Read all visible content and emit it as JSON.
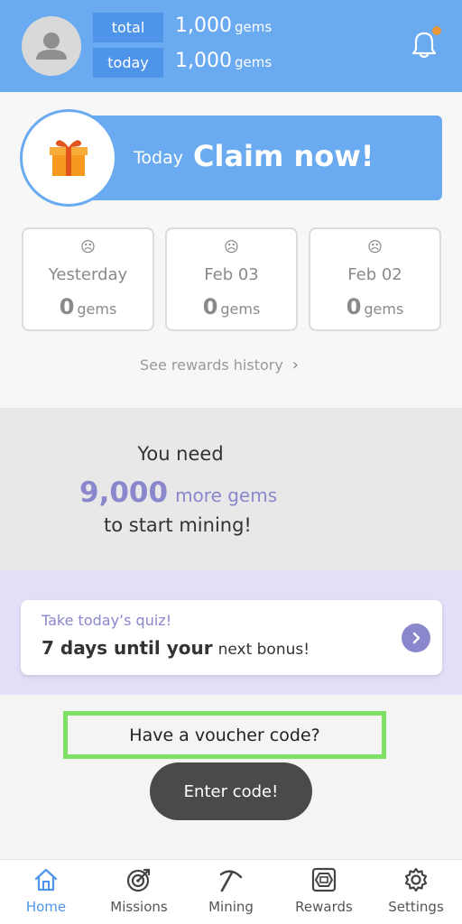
{
  "header": {
    "total_label": "total",
    "total_value": "1,000",
    "total_unit": "gems",
    "today_label": "today",
    "today_value": "1,000",
    "today_unit": "gems"
  },
  "claim": {
    "today_label": "Today",
    "cta": "Claim now!"
  },
  "history": {
    "days": [
      {
        "face": "☹",
        "name": "Yesterday",
        "gems": "0",
        "unit": "gems"
      },
      {
        "face": "☹",
        "name": "Feb 03",
        "gems": "0",
        "unit": "gems"
      },
      {
        "face": "☹",
        "name": "Feb 02",
        "gems": "0",
        "unit": "gems"
      }
    ],
    "link_label": "See rewards history",
    "link_chevron": "›"
  },
  "mining_need": {
    "line1": "You need",
    "amount": "9,000",
    "amount_suffix": "more gems",
    "line3": "to start mining!"
  },
  "quiz": {
    "title": "Take today’s quiz!",
    "subtitle_strong": "7 days until your",
    "subtitle_light": "next bonus!"
  },
  "voucher": {
    "question": "Have a voucher code?",
    "button_label": "Enter code!"
  },
  "nav": {
    "items": [
      {
        "label": "Home",
        "icon": "home-icon",
        "active": true
      },
      {
        "label": "Missions",
        "icon": "target-icon",
        "active": false
      },
      {
        "label": "Mining",
        "icon": "pickaxe-icon",
        "active": false
      },
      {
        "label": "Rewards",
        "icon": "gem-box-icon",
        "active": false
      },
      {
        "label": "Settings",
        "icon": "gear-icon",
        "active": false
      }
    ]
  },
  "colors": {
    "header_blue": "#6aaaf0",
    "label_blue": "#4e95ea",
    "accent_purple": "#8a87cc",
    "highlight_green": "#7ee065",
    "notification_orange": "#e8973a"
  }
}
